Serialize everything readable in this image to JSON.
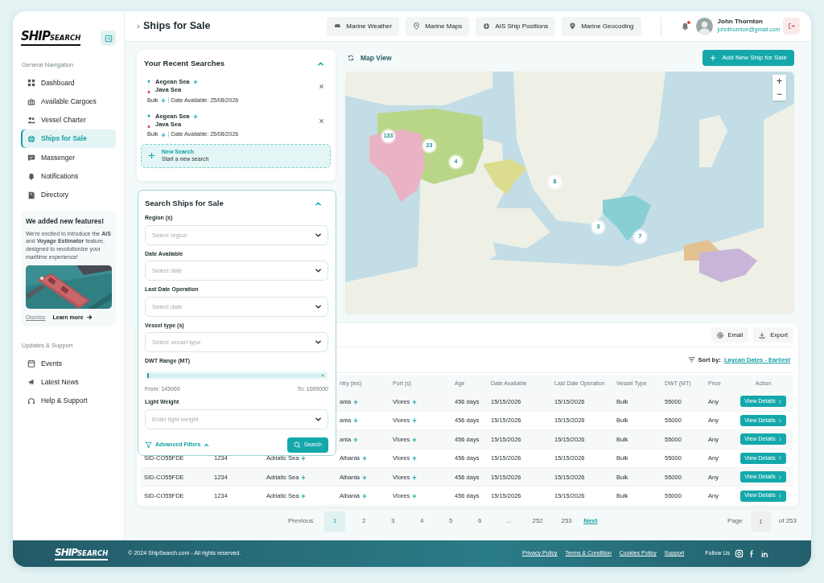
{
  "sidebar": {
    "brand": {
      "primary": "SHIP",
      "secondary": "SEARCH"
    },
    "sections": [
      {
        "title": "General Navigation",
        "items": [
          {
            "label": "Dashboard",
            "selected": false
          },
          {
            "label": "Available Cargoes",
            "selected": false
          },
          {
            "label": "Vessel Charter",
            "selected": false
          },
          {
            "label": "Ships for Sale",
            "selected": true
          },
          {
            "label": "Massenger",
            "selected": false
          },
          {
            "label": "Notifications",
            "selected": false
          },
          {
            "label": "Directory",
            "selected": false
          }
        ]
      },
      {
        "title": "Updates & Support",
        "items": [
          {
            "label": "Events",
            "selected": false
          },
          {
            "label": "Latest News",
            "selected": false
          },
          {
            "label": "Help & Support",
            "selected": false
          }
        ]
      }
    ],
    "promo": {
      "title": "We added new features!",
      "text": "We're excited to introduce the **AIS** and **Voyage Estimator** feature, designed to revolutionize your maritime experience!",
      "dismiss": "Dismiss",
      "learn_more": "Learn more"
    }
  },
  "topbar": {
    "title": "Ships for Sale",
    "tools": [
      "Marine Weather",
      "Marine Maps",
      "AIS Ship Positions",
      "Marine Geocoding"
    ],
    "notifications": {
      "unread": true
    },
    "user": {
      "name": "John Thornton",
      "email": "johnthornton@gmail.com"
    }
  },
  "recent_searches": {
    "title": "Your Recent Searches",
    "expanded": true,
    "items": [
      {
        "from": "Aegean Sea",
        "to": "Java Sea",
        "vessel": "Bulk",
        "date": "Date Available: 25/08/2026"
      },
      {
        "from": "Aegean Sea",
        "to": "Java Sea",
        "vessel": "Bulk",
        "date": "Date Available: 25/08/2026"
      }
    ],
    "new_search": {
      "title": "New Search",
      "subtitle": "Start a new search"
    }
  },
  "search_form": {
    "title": "Search Ships for Sale",
    "expanded": true,
    "fields": [
      {
        "kind": "select",
        "label": "Region (s)",
        "placeholder": "Select region"
      },
      {
        "kind": "select",
        "label": "Date Available",
        "placeholder": "Select date"
      },
      {
        "kind": "select",
        "label": "Last Date Operation",
        "placeholder": "Select date"
      },
      {
        "kind": "select",
        "label": "Vessel type (s)",
        "placeholder": "Select vessel type"
      },
      {
        "kind": "range",
        "label": "DWT Range (MT)",
        "level": 1,
        "from": "From: 145000",
        "to": "To: 1000000"
      },
      {
        "kind": "select",
        "label": "Light Weight",
        "placeholder": "Enter light weight"
      }
    ],
    "advanced": "Advanced Filters",
    "search_button": "Search"
  },
  "map": {
    "title": "Map View",
    "add_button": "Add New Ship for Sale",
    "clusters": [
      "133",
      "23",
      "4",
      "8",
      "3",
      "7"
    ],
    "zoom_in": "+",
    "zoom_out": "−"
  },
  "table": {
    "actions": [
      "Email",
      "Export"
    ],
    "sort_label": "Sort by:",
    "sort_value": "Laycan Dates - Earliest",
    "columns": [
      "ntry (ies)",
      "Port (s)",
      "Age",
      "Date Available",
      "Last Date Operation",
      "Vessel Type",
      "DWT (MT)",
      "Price",
      "Action"
    ],
    "rows": [
      [
        {
          "text": "ania",
          "more": true
        },
        {
          "text": "Vlores",
          "more": true
        },
        "456 days",
        "15/15/2026",
        "15/15/2026",
        "Bulk",
        "55000",
        "Any",
        {
          "kind": "button",
          "text": "View Details"
        }
      ],
      [
        {
          "text": "ania",
          "more": true
        },
        {
          "text": "Vlores",
          "more": true
        },
        "456 days",
        "15/15/2026",
        "15/15/2026",
        "Bulk",
        "55000",
        "Any",
        {
          "kind": "button",
          "text": "View Details"
        }
      ],
      [
        {
          "text": "ania",
          "more": true
        },
        {
          "text": "Vlores",
          "more": true
        },
        "456 days",
        "15/15/2026",
        "15/15/2026",
        "Bulk",
        "55000",
        "Any",
        {
          "kind": "button",
          "text": "View Details"
        }
      ],
      [
        "SID-CO55FDE",
        "1234",
        {
          "text": "Adriatic Sea",
          "more": true
        },
        {
          "text": "Albania",
          "more": true
        },
        {
          "text": "Vlores",
          "more": true
        },
        "456 days",
        "15/15/2026",
        "15/15/2026",
        "Bulk",
        "55000",
        "Any",
        {
          "kind": "button",
          "text": "View Details"
        }
      ],
      [
        "SID-CO55FDE",
        "1234",
        {
          "text": "Adriatic Sea",
          "more": true
        },
        {
          "text": "Albania",
          "more": true
        },
        {
          "text": "Vlores",
          "more": true
        },
        "456 days",
        "15/15/2026",
        "15/15/2026",
        "Bulk",
        "55000",
        "Any",
        {
          "kind": "button",
          "text": "View Details"
        }
      ],
      [
        "SID-CO55FDE",
        "1234",
        {
          "text": "Adriatic Sea",
          "more": true
        },
        {
          "text": "Albania",
          "more": true
        },
        {
          "text": "Vlores",
          "more": true
        },
        "456 days",
        "15/15/2026",
        "15/15/2026",
        "Bulk",
        "55000",
        "Any",
        {
          "kind": "button",
          "text": "View Details"
        }
      ]
    ]
  },
  "pagination": {
    "previous": "Previous",
    "pages": [
      {
        "label": "1",
        "selected": true
      },
      {
        "label": "2",
        "selected": false
      },
      {
        "label": "3",
        "selected": false
      },
      {
        "label": "4",
        "selected": false
      },
      {
        "label": "5",
        "selected": false
      },
      {
        "label": "6",
        "selected": false
      },
      {
        "label": "...",
        "selected": false
      },
      {
        "label": "252",
        "selected": false
      },
      {
        "label": "253",
        "selected": false
      }
    ],
    "next": "Next",
    "page_label": "Page",
    "page_input": "1",
    "of_label": "of 253"
  },
  "footer": {
    "brand": {
      "primary": "SHIP",
      "secondary": "SEARCH"
    },
    "copyright": "© 2024 ShipSearch.com - All rights reserved.",
    "links": [
      "Privacy Policy",
      "Terms & Condition",
      "Cookies Policy",
      "Support"
    ],
    "follow": "Follow Us"
  }
}
